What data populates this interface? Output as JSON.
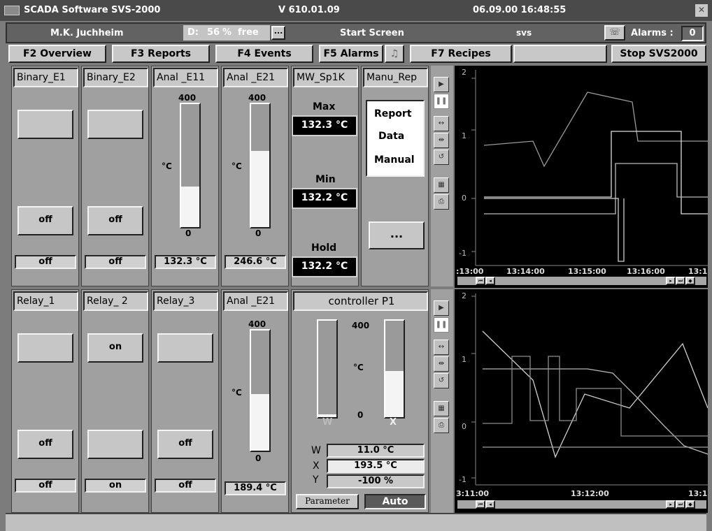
{
  "title_bar": {
    "app": "SCADA Software SVS-2000",
    "version": "V 610.01.09",
    "datetime": "06.09.00 16:48:55",
    "close": "✕"
  },
  "info_bar": {
    "user": "M.K. Juchheim",
    "disk_label": "D:",
    "disk_value": "56",
    "disk_unit": "%",
    "disk_free": "free",
    "disk_btn": "...",
    "screen": "Start Screen",
    "host": "svs",
    "alarms_label": "Alarms :",
    "alarms_count": "0"
  },
  "fkeys": {
    "f2": "F2 Overview",
    "f3": "F3 Reports",
    "f4": "F4 Events",
    "f5": "F5 Alarms",
    "f7": "F7 Recipes",
    "blank": "",
    "stop": "Stop SVS2000"
  },
  "top_panels": {
    "binary_e1": {
      "title": "Binary_E1",
      "btn": "off",
      "value": "off"
    },
    "binary_e2": {
      "title": "Binary_E2",
      "btn": "off",
      "value": "off"
    },
    "anal_e11": {
      "title": "Anal _E11",
      "max": "400",
      "min": "0",
      "unit": "°C",
      "value": "132.3 °C",
      "fill": 0.33
    },
    "anal_e21": {
      "title": "Anal _E21",
      "max": "400",
      "min": "0",
      "unit": "°C",
      "value": "246.6 °C",
      "fill": 0.62
    },
    "mw_sp1k": {
      "title": "MW_Sp1K",
      "max_label": "Max",
      "max_value": "132.3 °C",
      "min_label": "Min",
      "min_value": "132.2 °C",
      "hold_label": "Hold",
      "hold_value": "132.2 °C"
    },
    "manu_rep": {
      "title": "Manu_Rep",
      "line1": "Report",
      "line2": "Data",
      "line3": "Manual",
      "btn": "..."
    }
  },
  "bottom_panels": {
    "relay_1": {
      "title": "Relay_1",
      "top_btn": "",
      "btn": "off",
      "value": "off"
    },
    "relay_2": {
      "title": "Relay_ 2",
      "top_btn": "on",
      "btn": "",
      "value": "on"
    },
    "relay_3": {
      "title": "Relay_3",
      "top_btn": "",
      "btn": "off",
      "value": "off"
    },
    "anal_e21b": {
      "title": "Anal _E21",
      "max": "400",
      "min": "0",
      "unit": "°C",
      "value": "189.4 °C",
      "fill": 0.47
    },
    "controller": {
      "title": "controller P1",
      "max": "400",
      "min": "0",
      "unit": "°C",
      "w_mark": "W",
      "x_mark": "X",
      "w_label": "W",
      "w_value": "11.0 °C",
      "x_label": "X",
      "x_value": "193.5 °C",
      "y_label": "Y",
      "y_value": "-100 %",
      "param_btn": "Parameter",
      "mode": "Auto",
      "w_fill": 0.03,
      "x_fill": 0.48
    }
  },
  "trend_top": {
    "y_ticks": [
      "2",
      "1",
      "0",
      "-1"
    ],
    "x_ticks": [
      ":13:00",
      "13:14:00",
      "13:15:00",
      "13:16:00",
      "13:1"
    ]
  },
  "trend_bottom": {
    "y_ticks": [
      "2",
      "1",
      "0",
      "-1"
    ],
    "x_ticks": [
      "3:11:00",
      "13:12:00",
      "13:1"
    ]
  },
  "colors": {
    "background": "#7c7c7c",
    "panel": "#a0a0a0",
    "button": "#c6c6c6",
    "chart": "#000000"
  }
}
